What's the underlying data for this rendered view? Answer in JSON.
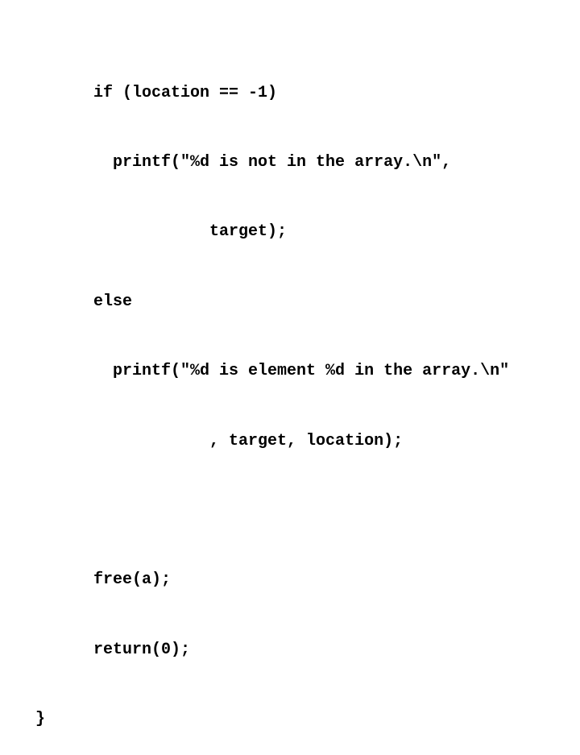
{
  "slide": {
    "code_lines": [
      "      if (location == -1)",
      "        printf(\"%d is not in the array.\\n\",",
      "                  target);",
      "      else",
      "        printf(\"%d is element %d in the array.\\n\"",
      "                  , target, location);",
      "",
      "      free(a);",
      "      return(0);",
      "}"
    ]
  }
}
